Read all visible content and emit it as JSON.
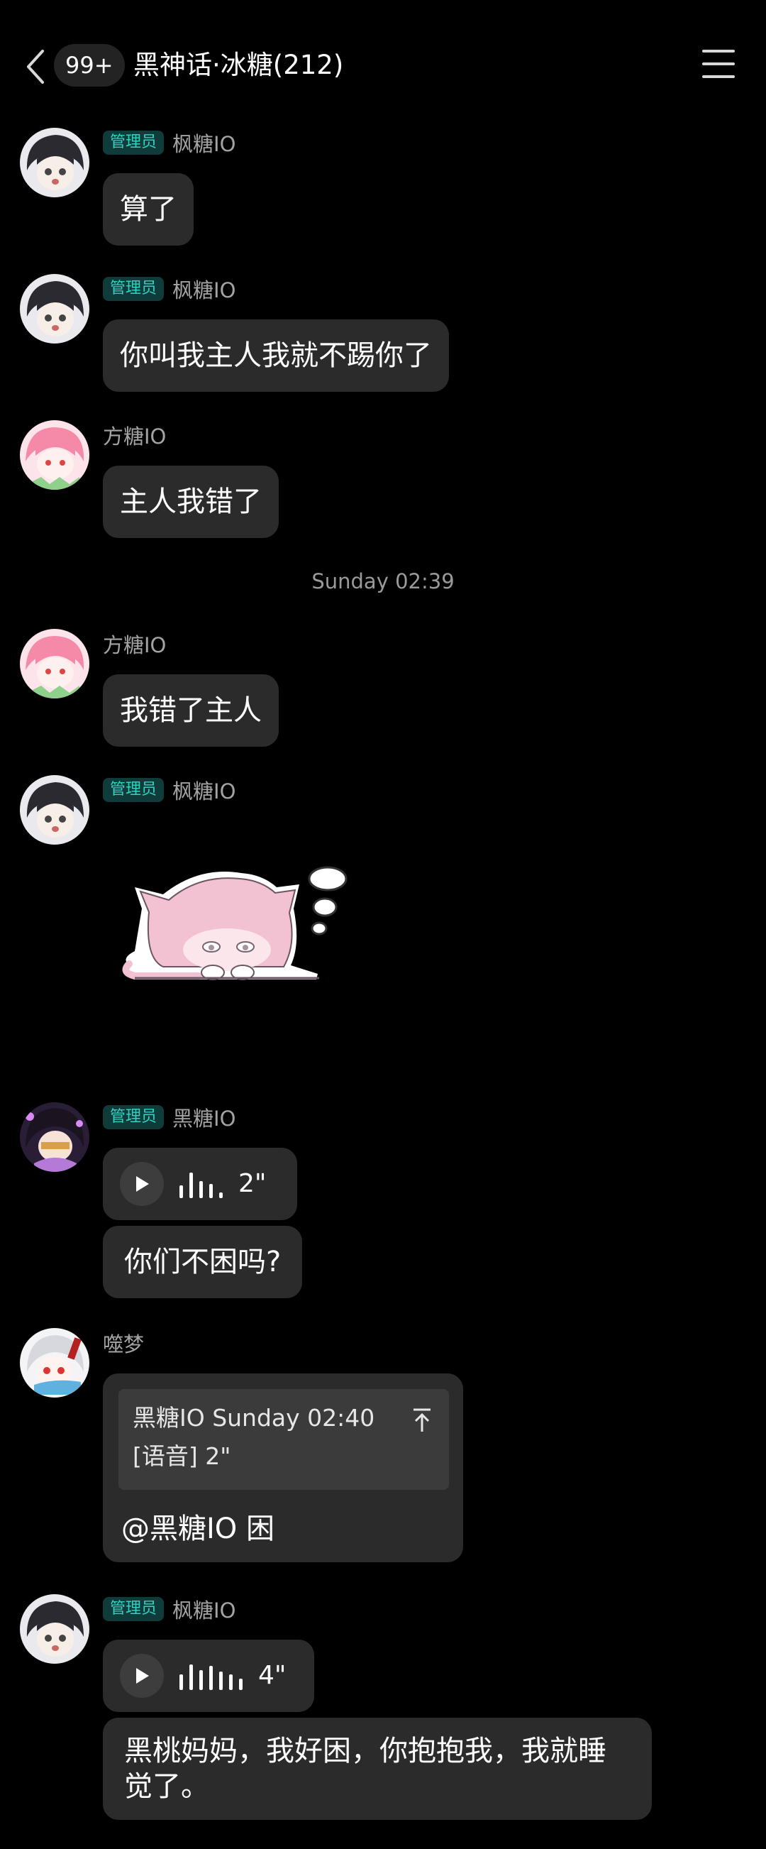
{
  "header": {
    "unread_count": "99+",
    "title": "黑神话·冰糖(212)"
  },
  "labels": {
    "admin": "管理员"
  },
  "messages": [
    {
      "sender": "枫糖IO",
      "text": "算了"
    },
    {
      "sender": "枫糖IO",
      "text": "你叫我主人我就不踢你了"
    },
    {
      "sender": "方糖IO",
      "text": "主人我错了"
    },
    {
      "sender": "方糖IO",
      "text": "我错了主人"
    },
    {
      "sender": "枫糖IO"
    },
    {
      "sender": "黑糖IO",
      "voice_duration": "2\"",
      "text": "你们不困吗?"
    },
    {
      "sender": "噬梦",
      "quote": {
        "author_time": "黑糖IO Sunday 02:40",
        "content": "[语音] 2\""
      },
      "text": "@黑糖IO 困"
    },
    {
      "sender": "枫糖IO",
      "voice_duration": "4\"",
      "text": "黑桃妈妈，我好困，你抱抱我，我就睡觉了。"
    }
  ],
  "timestamp": "Sunday 02:39",
  "colors": {
    "background": "#000000",
    "bubble": "#2b2b2b",
    "admin_badge_bg": "#0f3b3a",
    "admin_badge_text": "#2fd3c2",
    "sender_name": "#a3a3a3"
  }
}
